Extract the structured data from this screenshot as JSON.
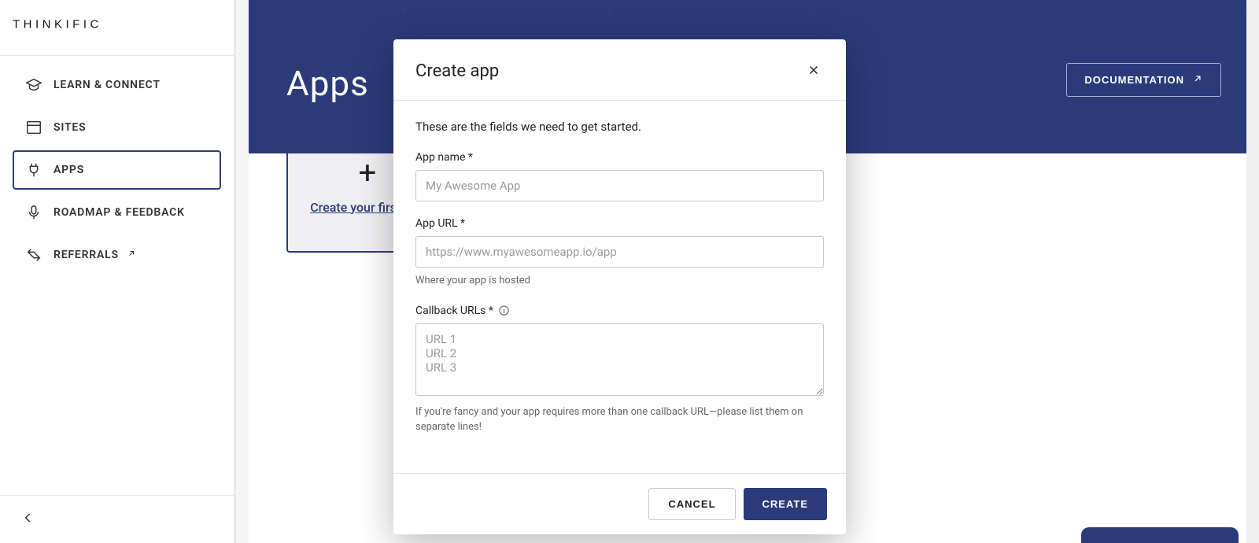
{
  "brand": "THINKIFIC",
  "sidebar": {
    "items": [
      {
        "label": "LEARN & CONNECT",
        "icon": "graduation-cap-icon"
      },
      {
        "label": "SITES",
        "icon": "browser-window-icon"
      },
      {
        "label": "APPS",
        "icon": "plug-icon"
      },
      {
        "label": "ROADMAP & FEEDBACK",
        "icon": "microphone-icon"
      },
      {
        "label": "REFERRALS",
        "icon": "handshake-icon",
        "external": true
      }
    ],
    "active_index": 2
  },
  "page": {
    "title": "Apps",
    "documentation_label": "DOCUMENTATION",
    "create_card_label": "Create your first app"
  },
  "modal": {
    "title": "Create app",
    "intro": "These are the fields we need to get started.",
    "app_name_label": "App name *",
    "app_name_placeholder": "My Awesome App",
    "app_name_value": "",
    "app_url_label": "App URL *",
    "app_url_placeholder": "https://www.myawesomeapp.io/app",
    "app_url_value": "",
    "app_url_helper": "Where your app is hosted",
    "callback_label": "Callback URLs *",
    "callback_placeholder": "URL 1\nURL 2\nURL 3",
    "callback_value": "",
    "callback_helper": "If you're fancy and your app requires more than one callback URL—please list them on separate lines!",
    "cancel_label": "CANCEL",
    "create_label": "CREATE"
  },
  "colors": {
    "primary": "#2b3b7a",
    "text": "#222222",
    "muted": "#666666",
    "border": "#c8c8c8"
  }
}
